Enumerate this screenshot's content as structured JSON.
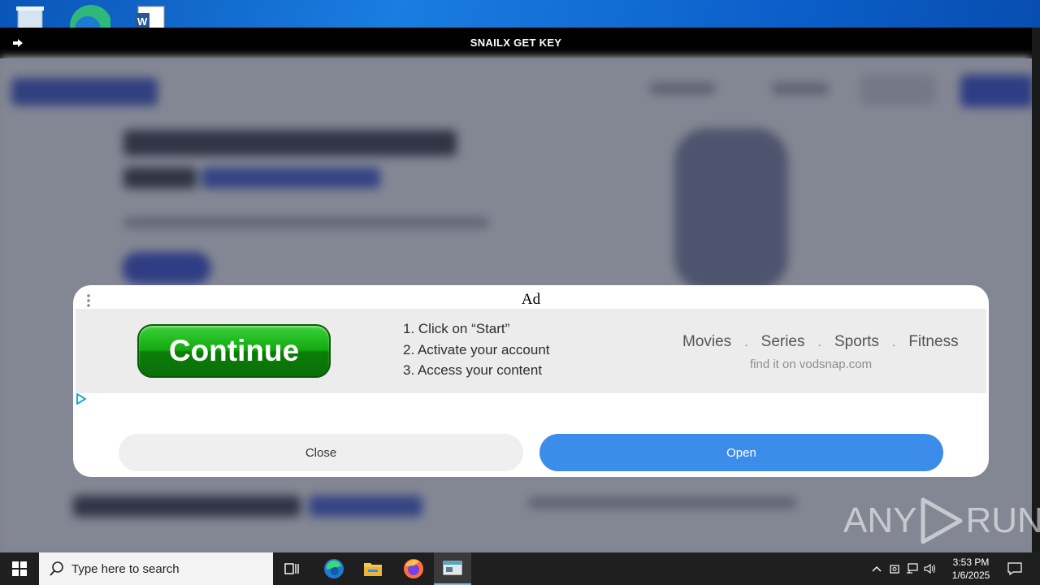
{
  "window": {
    "title": "SNAILX GET KEY"
  },
  "ad": {
    "title": "Ad",
    "continue_label": "Continue",
    "steps": [
      "1. Click on “Start”",
      "2. Activate your account",
      "3. Access your content"
    ],
    "categories": [
      "Movies",
      "Series",
      "Sports",
      "Fitness"
    ],
    "category_separator": ".",
    "site": "find it on vodsnap.com",
    "close_label": "Close",
    "open_label": "Open"
  },
  "watermark": {
    "left": "ANY",
    "right": "RUN"
  },
  "taskbar": {
    "search_placeholder": "Type here to search",
    "time": "3:53 PM",
    "date": "1/6/2025"
  },
  "colors": {
    "titlebar": "#000000",
    "open_button": "#3c8cea",
    "close_button": "#efefef",
    "continue_green": "#13a80f",
    "taskbar": "#1f1f1f"
  },
  "icons": {
    "titlebar": "arrow-right-icon",
    "ad_menu": "kebab-menu-icon",
    "ad_choices": "ad-choices-icon",
    "start": "windows-logo-icon",
    "search": "search-icon"
  }
}
